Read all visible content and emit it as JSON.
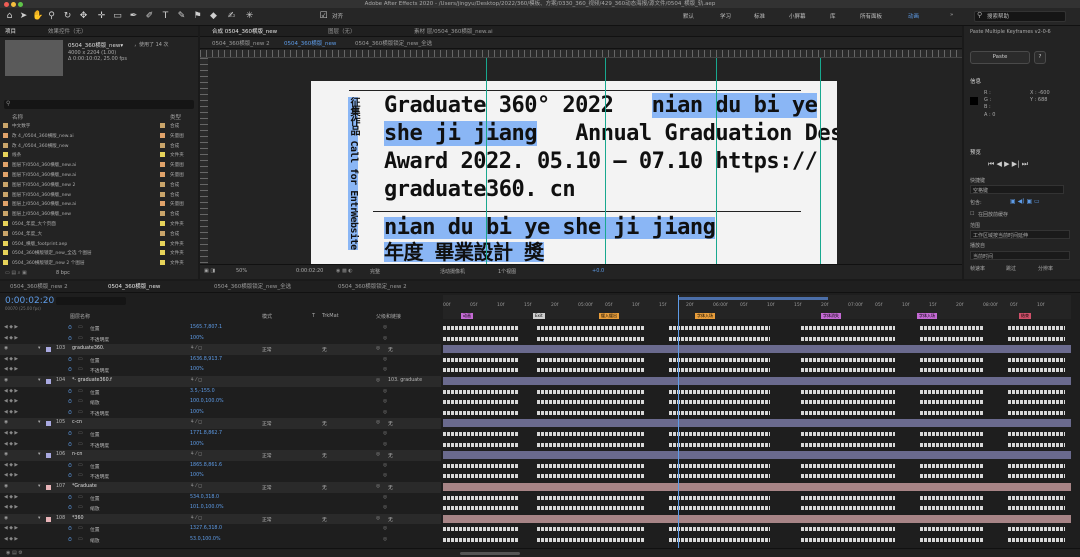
{
  "window": {
    "title": "Adobe After Effects 2020 - /Users/jingyu/Desktop/2022/360/模板、方案/0330_360_视频/429_360动态海报/源文件/0504_横版_轨.aep"
  },
  "toolbar": {
    "align_label": "对齐",
    "workspaces": [
      "默认",
      "学习",
      "标准",
      "小屏幕",
      "库",
      "所有面板",
      "动画"
    ],
    "active_workspace": "动画",
    "search_placeholder": "搜索帮助"
  },
  "project": {
    "tab": "项目",
    "tab2": "效果控件（无）",
    "item_name": "0504_360横版_new▾",
    "used_info": "，使用了 14 次",
    "dims": "4000 x 2204 (1.00)",
    "duration": "Δ 0:00:10:02, 25.00 fps",
    "col_name": "名称",
    "col_type": "类型",
    "bpc": "8 bpc",
    "rows": [
      {
        "name": "中文数字",
        "type": "合成",
        "color": "#c9a46a"
      },
      {
        "name": "改 4_/0504_360横版_new.ai",
        "type": "矢量图",
        "color": "#e0a26a"
      },
      {
        "name": "改 4_/0504_360横版_new",
        "type": "合成",
        "color": "#c9a46a"
      },
      {
        "name": "线条",
        "type": "文件夹",
        "color": "#e7d35a"
      },
      {
        "name": "图层下/0504_360横版_new.ai",
        "type": "矢量图",
        "color": "#e0a26a"
      },
      {
        "name": "图层下/0504_360横版_new.ai",
        "type": "矢量图",
        "color": "#e0a26a"
      },
      {
        "name": "图层下/0504_360横版_new 2",
        "type": "合成",
        "color": "#c9a46a"
      },
      {
        "name": "图层下/0504_360横版_new",
        "type": "合成",
        "color": "#c9a46a"
      },
      {
        "name": "图层上/0504_360横版_new.ai",
        "type": "矢量图",
        "color": "#e0a26a"
      },
      {
        "name": "图层上/0504_360横版_new",
        "type": "合成",
        "color": "#c9a46a"
      },
      {
        "name": "0504_年度_大个页面",
        "type": "文件夹",
        "color": "#e7d35a"
      },
      {
        "name": "0504_年度_大",
        "type": "合成",
        "color": "#c9a46a"
      },
      {
        "name": "0504_横版_footprint.aep",
        "type": "文件夹",
        "color": "#e7d35a"
      },
      {
        "name": "0504_360横版锁定_new_全选 个图层",
        "type": "文件夹",
        "color": "#e7d35a"
      },
      {
        "name": "0504_360横版锁定_new 2 个图层",
        "type": "文件夹",
        "color": "#e7d35a"
      }
    ]
  },
  "composition": {
    "tab_label": "合成 0504_360横版_new",
    "layer_tab": "图层（无）",
    "footage_tab": "素材 层/0504_360横版_new.ai",
    "subtabs": [
      "0504_360横版_new 2",
      "0504_360横版_new",
      "0504_360横版锁定_new_全选"
    ],
    "active_subtab": 1,
    "zoom": "50%",
    "timecode": "0:00:02:20",
    "quality": "完整",
    "camera": "活动摄像机",
    "views": "1个视图",
    "exposure": "+0.0"
  },
  "poster": {
    "line1a": "Graduate 360° 2022",
    "line1b": "nian du bi ye",
    "line2a": "she ji jiang",
    "line2b": "Annual Graduation Design",
    "line3": "Award 2022. 05.10 – 07.10 https://",
    "line4": "graduate360. cn",
    "line5": "nian  du  bi  ye  she  ji  jiang",
    "line6": "年度 畢業設計 獎",
    "side1": "征集作品 Call for Entry",
    "side2": "Website"
  },
  "right": {
    "script_title": "Paste Multiple Keyframes v2-0-6",
    "paste_label": "Paste",
    "help_label": "?",
    "info_title": "信息",
    "info_r": "R :",
    "info_g": "G :",
    "info_b": "B :",
    "info_a": "A : 0",
    "info_x": "X : -600",
    "info_y": "Y : 688",
    "preview_title": "预览",
    "shortcut_label": "快捷键",
    "shortcut_value": "空格键",
    "include_label": "包含:",
    "cache_label": "在回放前缓存",
    "range_label": "范围",
    "range_value": "工作区域按当前时间延伸",
    "play_from_label": "播放自",
    "play_from_value": "当前时间",
    "fps_label": "帧速率",
    "skip_label": "跳过",
    "res_label": "分辨率"
  },
  "timeline": {
    "tabs": [
      "0504_360横版_new 2",
      "0504_360横版_new",
      "0504_360横版锁定_new_全选",
      "0504_360横版锁定_new 2"
    ],
    "active_tab": 1,
    "timecode": "0:00:02:20",
    "frames": "00070 (25.00 fps)",
    "col_layer": "图层名称",
    "col_mode": "模式",
    "col_t": "T",
    "col_trkmat": "TrkMat",
    "col_parent": "父级和链接",
    "ruler": [
      "00f",
      "05f",
      "10f",
      "15f",
      "20f",
      "05:00f",
      "05f",
      "10f",
      "15f",
      "20f",
      "06:00f",
      "05f",
      "10f",
      "15f",
      "20f",
      "07:00f",
      "05f",
      "10f",
      "15f",
      "20f",
      "08:00f",
      "05f",
      "10f"
    ],
    "markers": [
      {
        "label": "动画",
        "color": "#c46ad4",
        "pos": 0.03
      },
      {
        "label": "Exit",
        "color": "#cfcfcf",
        "pos": 0.15
      },
      {
        "label": "缓入缓出",
        "color": "#e89d3a",
        "pos": 0.26
      },
      {
        "label": "字体入场",
        "color": "#e89d3a",
        "pos": 0.42
      },
      {
        "label": "字体消失",
        "color": "#c46ad4",
        "pos": 0.63
      },
      {
        "label": "字体入场",
        "color": "#c46ad4",
        "pos": 0.79
      },
      {
        "label": "结束",
        "color": "#d0506a",
        "pos": 0.96
      }
    ],
    "rows": [
      {
        "kind": "prop",
        "name": "位置",
        "value": "1565.7,807.1"
      },
      {
        "kind": "prop",
        "name": "不透明度",
        "value": "100%"
      },
      {
        "kind": "layer",
        "num": "103",
        "name": "graduate360.",
        "mode": "正常",
        "trk": "无",
        "parent": "无",
        "color": "#a9a9e0"
      },
      {
        "kind": "prop",
        "name": "位置",
        "value": "1636.8,913.7"
      },
      {
        "kind": "prop",
        "name": "不透明度",
        "value": "100%"
      },
      {
        "kind": "layer",
        "num": "104",
        "name": "*- graduate360.f",
        "mode": "",
        "trk": "",
        "parent": "103. graduate",
        "color": "#a9a9e0"
      },
      {
        "kind": "prop",
        "name": "位置",
        "value": "3.5,-155.0"
      },
      {
        "kind": "prop",
        "name": "缩放",
        "value": "100.0,100.0%"
      },
      {
        "kind": "prop",
        "name": "不透明度",
        "value": "100%"
      },
      {
        "kind": "layer",
        "num": "105",
        "name": "c-cn",
        "mode": "正常",
        "trk": "无",
        "parent": "无",
        "color": "#a9a9e0"
      },
      {
        "kind": "prop",
        "name": "位置",
        "value": "1771.8,862.7"
      },
      {
        "kind": "prop",
        "name": "不透明度",
        "value": "100%"
      },
      {
        "kind": "layer",
        "num": "106",
        "name": "n-cn",
        "mode": "正常",
        "trk": "无",
        "parent": "无",
        "color": "#a9a9e0"
      },
      {
        "kind": "prop",
        "name": "位置",
        "value": "1865.8,861.6"
      },
      {
        "kind": "prop",
        "name": "不透明度",
        "value": "100%"
      },
      {
        "kind": "layer",
        "num": "107",
        "name": "*Graduate",
        "mode": "正常",
        "trk": "无",
        "parent": "无",
        "color": "#e8b4b8"
      },
      {
        "kind": "prop",
        "name": "位置",
        "value": "534.0,318.0"
      },
      {
        "kind": "prop",
        "name": "缩放",
        "value": "101.0,100.0%"
      },
      {
        "kind": "layer",
        "num": "108",
        "name": "*360",
        "mode": "正常",
        "trk": "无",
        "parent": "无",
        "color": "#e8b4b8"
      },
      {
        "kind": "prop",
        "name": "位置",
        "value": "1327.6,318.0"
      },
      {
        "kind": "prop",
        "name": "缩放",
        "value": "53.0,100.0%"
      }
    ]
  }
}
